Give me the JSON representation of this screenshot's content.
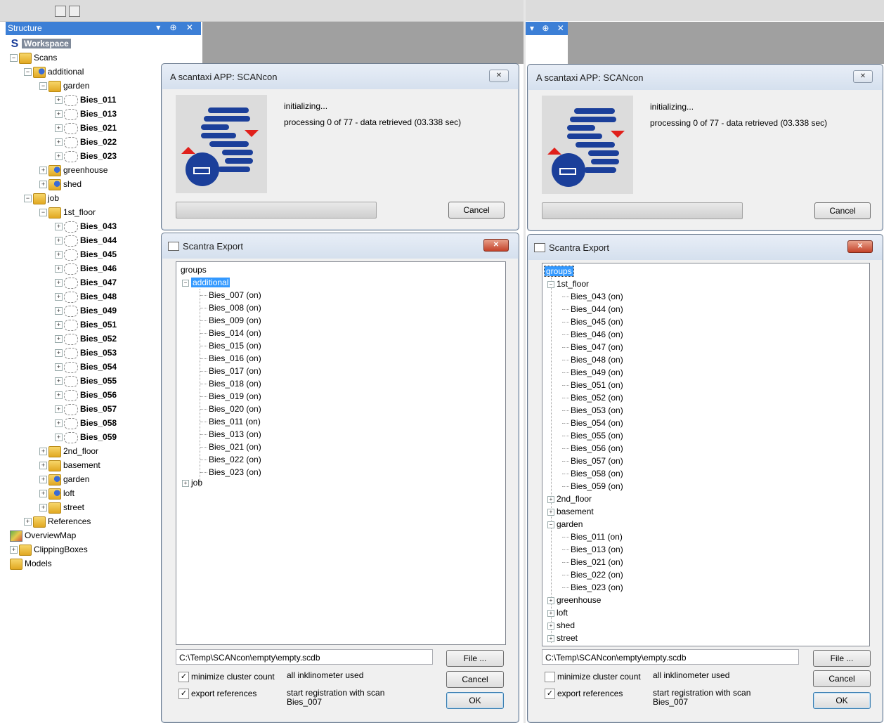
{
  "structure": {
    "header_title": "Structure",
    "header_controls": "▾ ⊕ ✕",
    "tree": [
      {
        "label": "Workspace"
      },
      {
        "label": "Scans"
      },
      {
        "label": "additional"
      },
      {
        "label": "garden"
      },
      {
        "label": "Bies_011"
      },
      {
        "label": "Bies_013"
      },
      {
        "label": "Bies_021"
      },
      {
        "label": "Bies_022"
      },
      {
        "label": "Bies_023"
      },
      {
        "label": "greenhouse"
      },
      {
        "label": "shed"
      },
      {
        "label": "job"
      },
      {
        "label": "1st_floor"
      },
      {
        "label": "Bies_043"
      },
      {
        "label": "Bies_044"
      },
      {
        "label": "Bies_045"
      },
      {
        "label": "Bies_046"
      },
      {
        "label": "Bies_047"
      },
      {
        "label": "Bies_048"
      },
      {
        "label": "Bies_049"
      },
      {
        "label": "Bies_051"
      },
      {
        "label": "Bies_052"
      },
      {
        "label": "Bies_053"
      },
      {
        "label": "Bies_054"
      },
      {
        "label": "Bies_055"
      },
      {
        "label": "Bies_056"
      },
      {
        "label": "Bies_057"
      },
      {
        "label": "Bies_058"
      },
      {
        "label": "Bies_059"
      },
      {
        "label": "2nd_floor"
      },
      {
        "label": "basement"
      },
      {
        "label": "garden"
      },
      {
        "label": "loft"
      },
      {
        "label": "street"
      },
      {
        "label": "References"
      },
      {
        "label": "OverviewMap"
      },
      {
        "label": "ClippingBoxes"
      },
      {
        "label": "Models"
      }
    ]
  },
  "right_panel_controls": "▾ ⊕ ✕",
  "progress_dialog": {
    "title": "A scantaxi APP: SCANcon",
    "status_line1": "initializing...",
    "status_line2": "processing  0 of 77 - data retrieved (03.338 sec)",
    "cancel_label": "Cancel",
    "close_label": "✕"
  },
  "export_dialog_left": {
    "title": "Scantra Export",
    "close_label": "✕",
    "root": "groups",
    "group": "additional",
    "items": [
      "Bies_007 (on)",
      "Bies_008 (on)",
      "Bies_009 (on)",
      "Bies_014 (on)",
      "Bies_015 (on)",
      "Bies_016 (on)",
      "Bies_017 (on)",
      "Bies_018 (on)",
      "Bies_019 (on)",
      "Bies_020 (on)",
      "Bies_011 (on)",
      "Bies_013 (on)",
      "Bies_021 (on)",
      "Bies_022 (on)",
      "Bies_023 (on)"
    ],
    "collapsed_group": "job",
    "path_value": "C:\\Temp\\SCANcon\\empty\\empty.scdb",
    "file_button": "File ...",
    "cancel_button": "Cancel",
    "ok_button": "OK",
    "minimize_label": "minimize cluster count",
    "export_refs_label": "export references",
    "info_inklinometer": "all inklinometer used",
    "info_registration_1": "start registration with scan",
    "info_registration_2": "Bies_007",
    "minimize_checked": true,
    "export_refs_checked": true
  },
  "export_dialog_right": {
    "title": "Scantra Export",
    "close_label": "✕",
    "root": "groups",
    "group1": "1st_floor",
    "group1_items": [
      "Bies_043 (on)",
      "Bies_044 (on)",
      "Bies_045 (on)",
      "Bies_046 (on)",
      "Bies_047 (on)",
      "Bies_048 (on)",
      "Bies_049 (on)",
      "Bies_051 (on)",
      "Bies_052 (on)",
      "Bies_053 (on)",
      "Bies_054 (on)",
      "Bies_055 (on)",
      "Bies_056 (on)",
      "Bies_057 (on)",
      "Bies_058 (on)",
      "Bies_059 (on)"
    ],
    "collapsed_a": [
      "2nd_floor",
      "basement"
    ],
    "group2": "garden",
    "group2_items": [
      "Bies_011 (on)",
      "Bies_013 (on)",
      "Bies_021 (on)",
      "Bies_022 (on)",
      "Bies_023 (on)"
    ],
    "collapsed_b": [
      "greenhouse",
      "loft",
      "shed",
      "street"
    ],
    "path_value": "C:\\Temp\\SCANcon\\empty\\empty.scdb",
    "file_button": "File ...",
    "cancel_button": "Cancel",
    "ok_button": "OK",
    "minimize_label": "minimize cluster count",
    "export_refs_label": "export references",
    "info_inklinometer": "all inklinometer used",
    "info_registration_1": "start registration with scan",
    "info_registration_2": "Bies_007",
    "minimize_checked": false,
    "export_refs_checked": true
  },
  "colors": {
    "accent": "#3c7fd6",
    "selection": "#3399ff",
    "logo_blue": "#1b3f9a",
    "logo_red": "#e0201b"
  }
}
